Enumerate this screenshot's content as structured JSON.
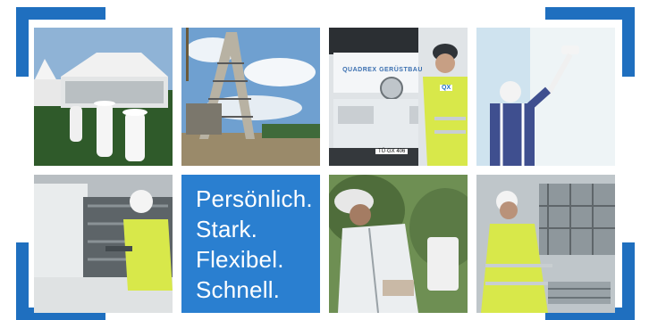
{
  "slogan": {
    "lines": [
      "Persönlich.",
      "Stark.",
      "Flexibel.",
      "Schnell."
    ]
  },
  "truck_sign": {
    "left": "QUADREX",
    "right": "GERÜSTBAU"
  },
  "license_plate": "TÜ·GX 406",
  "vest_badge": "QX",
  "colors": {
    "brand_blue": "#2a7fd0",
    "corner_blue": "#1f6fbf",
    "vest_yellow": "#d8e84a"
  },
  "photos": [
    "event-tent-photo",
    "scaffold-tower-photo",
    "truck-worker-photo",
    "painter-photo",
    "delivery-truck-photo",
    "worker-with-tablet-photo",
    "scaffold-construction-photo"
  ]
}
